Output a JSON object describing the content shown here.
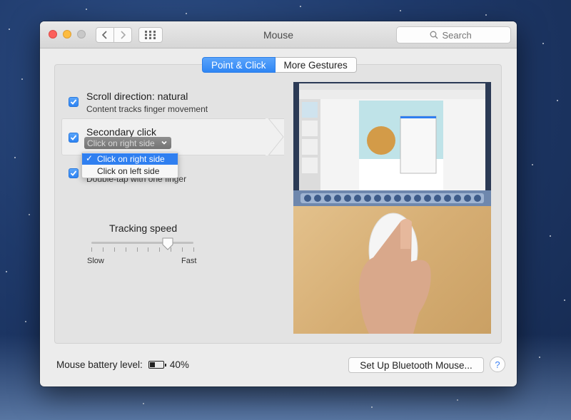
{
  "window": {
    "title": "Mouse"
  },
  "search": {
    "placeholder": "Search"
  },
  "tabs": [
    {
      "label": "Point & Click",
      "active": true
    },
    {
      "label": "More Gestures",
      "active": false
    }
  ],
  "options": [
    {
      "title": "Scroll direction: natural",
      "subtitle": "Content tracks finger movement",
      "checked": true
    },
    {
      "title": "Secondary click",
      "subtitle": "Click on right side",
      "checked": true
    },
    {
      "title": "",
      "subtitle": "Double-tap with one finger",
      "checked": true
    }
  ],
  "secondary_click_menu": {
    "items": [
      {
        "label": "Click on right side",
        "selected": true
      },
      {
        "label": "Click on left side",
        "selected": false
      }
    ]
  },
  "tracking": {
    "label": "Tracking speed",
    "min_label": "Slow",
    "max_label": "Fast",
    "value_fraction": 0.75
  },
  "footer": {
    "battery_label": "Mouse battery level:",
    "battery_percent": "40%",
    "battery_fraction": 0.4,
    "setup_button": "Set Up Bluetooth Mouse...",
    "help_button": "?"
  },
  "colors": {
    "accent": "#2f86f4",
    "window_bg": "#ececec"
  }
}
